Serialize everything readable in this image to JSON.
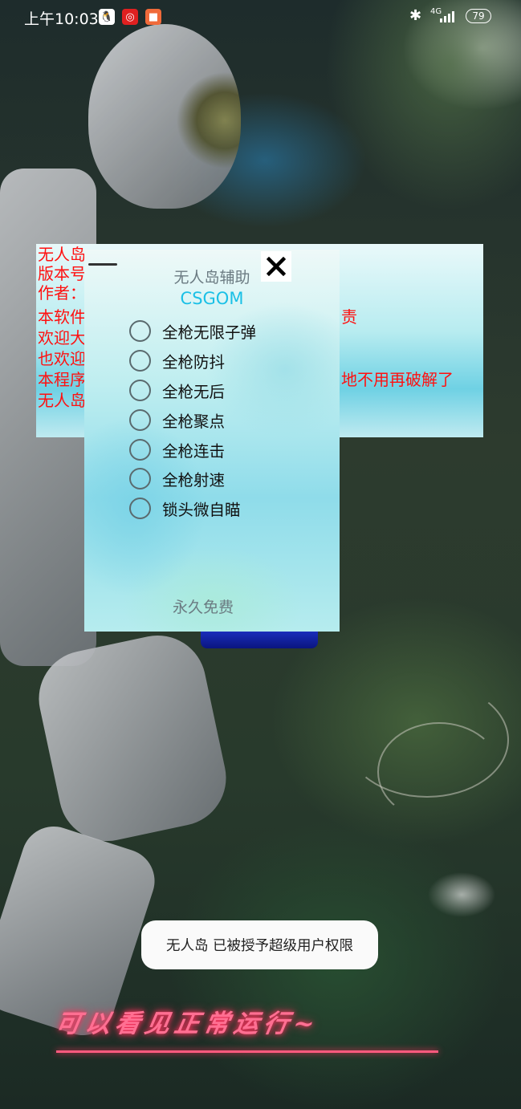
{
  "status_bar": {
    "time": "上午10:03",
    "network": "4G",
    "battery": "79",
    "app_icons": [
      "qq-icon",
      "netease-music-icon",
      "video-icon"
    ]
  },
  "info_panel": {
    "lines": [
      {
        "start": "无人岛",
        "end": ""
      },
      {
        "start": "版本号",
        "end": ""
      },
      {
        "start": "作者：",
        "end": ""
      },
      {
        "start": "本软件",
        "end": "责"
      },
      {
        "start": "欢迎大",
        "end": ""
      },
      {
        "start": "也欢迎",
        "end": ""
      },
      {
        "start": "本程序",
        "end": "地不用再破解了"
      },
      {
        "start": "无人岛",
        "end": ""
      }
    ]
  },
  "dialog": {
    "title": "无人岛辅助",
    "subtitle": "CSGOM",
    "options": [
      {
        "label": "全枪无限子弹",
        "checked": false
      },
      {
        "label": "全枪防抖",
        "checked": false
      },
      {
        "label": "全枪无后",
        "checked": false
      },
      {
        "label": "全枪聚点",
        "checked": false
      },
      {
        "label": "全枪连击",
        "checked": false
      },
      {
        "label": "全枪射速",
        "checked": false
      },
      {
        "label": "锁头微自瞄",
        "checked": false
      }
    ],
    "footer": "永久免费"
  },
  "toast": {
    "text": "无人岛 已被授予超级用户权限"
  },
  "watermark": {
    "text": "可以看见正常运行~"
  },
  "colors": {
    "info_text": "#ff1010",
    "subtitle": "#1bc0e6",
    "neon": "#ff6f92"
  }
}
